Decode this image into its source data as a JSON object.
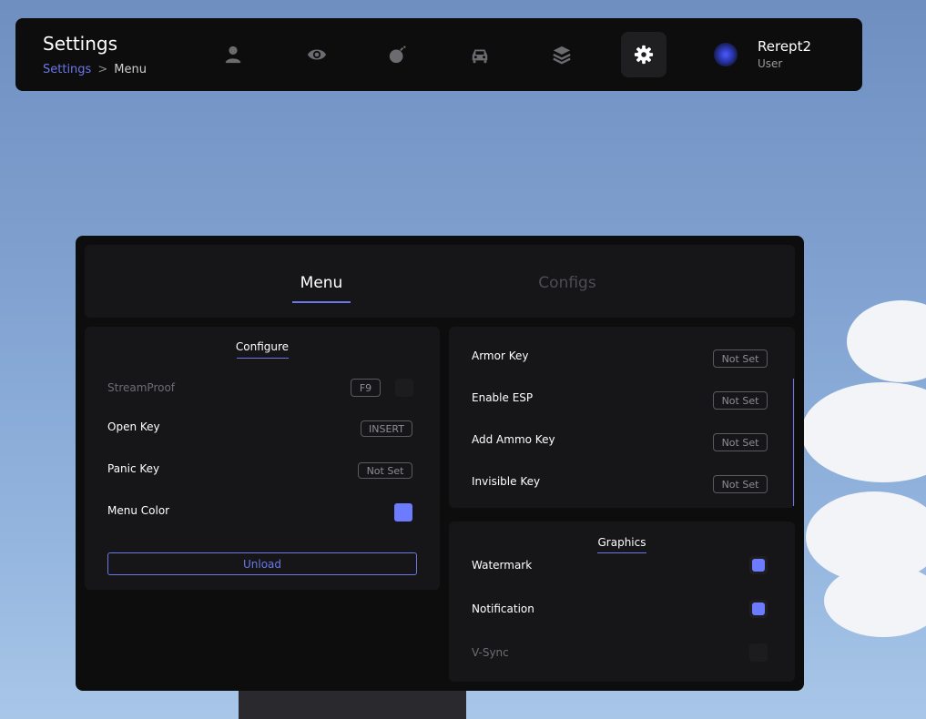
{
  "header": {
    "title": "Settings",
    "breadcrumb": {
      "parent": "Settings",
      "separator": ">",
      "current": "Menu"
    },
    "nav_icons": [
      "user-icon",
      "eye-icon",
      "bomb-icon",
      "car-icon",
      "layers-icon",
      "gear-icon"
    ],
    "active_nav": "gear-icon",
    "user": {
      "name": "Rerept2",
      "role": "User"
    }
  },
  "tabs": [
    {
      "label": "Menu",
      "active": true
    },
    {
      "label": "Configs",
      "active": false
    }
  ],
  "configure": {
    "title": "Configure",
    "streamproof": {
      "label": "StreamProof",
      "key": "F9",
      "enabled": false
    },
    "open_key": {
      "label": "Open Key",
      "key": "INSERT"
    },
    "panic_key": {
      "label": "Panic Key",
      "key": "Not Set"
    },
    "menu_color": {
      "label": "Menu Color",
      "color": "#6d7cff"
    },
    "unload_label": "Unload"
  },
  "keybinds": [
    {
      "label": "Armor Key",
      "key": "Not Set"
    },
    {
      "label": "Enable ESP",
      "key": "Not Set"
    },
    {
      "label": "Add Ammo Key",
      "key": "Not Set"
    },
    {
      "label": "Invisible Key",
      "key": "Not Set"
    }
  ],
  "graphics": {
    "title": "Graphics",
    "items": [
      {
        "label": "Watermark",
        "checked": true
      },
      {
        "label": "Notification",
        "checked": true
      },
      {
        "label": "V-Sync",
        "checked": false
      }
    ]
  },
  "colors": {
    "accent": "#6a78e8",
    "panel": "#0d0d0e",
    "card": "#161618"
  }
}
